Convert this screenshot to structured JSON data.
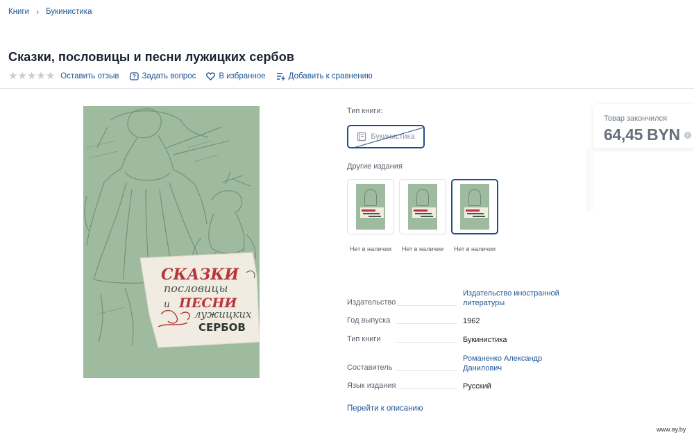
{
  "breadcrumb": [
    "Книги",
    "Букинистика"
  ],
  "page_title": "Сказки, пословицы и песни лужицких сербов",
  "rating": {
    "stars_total": 5,
    "stars_filled": 0
  },
  "actions": {
    "review": "Оставить отзыв",
    "question": "Задать вопрос",
    "favorite": "В избранное",
    "compare": "Добавить к сравнению"
  },
  "cover": {
    "line1": "СКАЗКИ",
    "line2": "пословицы",
    "line3": "и",
    "line4": "ПЕСНИ",
    "line5": "лужицких",
    "line6": "СЕРБОВ"
  },
  "book_type": {
    "label": "Тип книги:",
    "option": "Букинистика"
  },
  "other_editions": {
    "label": "Другие издания",
    "items": [
      {
        "status": "Нет в наличии",
        "selected": false
      },
      {
        "status": "Нет в наличии",
        "selected": false
      },
      {
        "status": "Нет в наличии",
        "selected": true
      }
    ]
  },
  "specs": [
    {
      "key": "Издательство",
      "value_lines": [
        "Издательство иностранной",
        "литературы"
      ],
      "link": true
    },
    {
      "key": "Год выпуска",
      "value_lines": [
        "1962"
      ],
      "link": false
    },
    {
      "key": "Тип книги",
      "value_lines": [
        "Букинистика"
      ],
      "link": false
    },
    {
      "key": "Составитель",
      "value_lines": [
        "Романенко Александр",
        "Данилович"
      ],
      "link": true
    },
    {
      "key": "Язык издания",
      "value_lines": [
        "Русский"
      ],
      "link": false
    }
  ],
  "goto_description": "Перейти к описанию",
  "price_card": {
    "status": "Товар закончился",
    "price": "64,45 BYN",
    "info_icon": "i"
  },
  "watermark": "www.ay.by",
  "colors": {
    "link": "#1f5596",
    "accent_border": "#1f4e8a",
    "cover_green": "#9ebba0",
    "cover_red": "#b8343b"
  }
}
